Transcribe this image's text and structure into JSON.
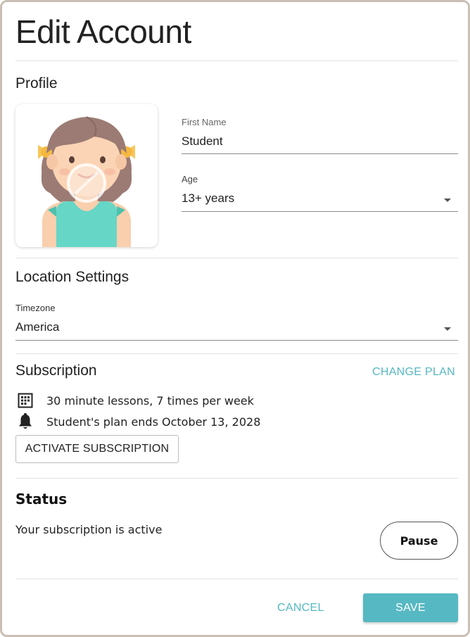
{
  "page": {
    "title": "Edit Account"
  },
  "profile": {
    "heading": "Profile",
    "avatar_icon": "girl-avatar-icon",
    "first_name": {
      "label": "First Name",
      "value": "Student"
    },
    "age": {
      "label": "Age",
      "value": "13+ years"
    }
  },
  "location": {
    "heading": "Location Settings",
    "timezone": {
      "label": "Timezone",
      "value": "America"
    }
  },
  "subscription": {
    "heading": "Subscription",
    "change_plan_label": "CHANGE PLAN",
    "lessons_text": "30 minute lessons, 7 times per week",
    "plan_end_text": "Student's plan ends October 13, 2028",
    "activate_label": "ACTIVATE SUBSCRIPTION"
  },
  "status": {
    "heading": "Status",
    "text": "Your subscription is active",
    "pause_label": "Pause"
  },
  "footer": {
    "cancel_label": "CANCEL",
    "save_label": "SAVE"
  },
  "colors": {
    "accent": "#56b8c2",
    "frame_border": "#c9bfb5"
  }
}
